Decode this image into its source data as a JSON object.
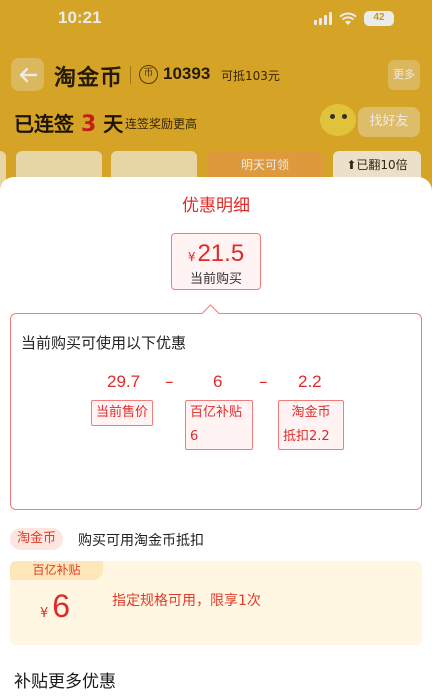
{
  "status_bar": {
    "time": "10:21",
    "battery": "42"
  },
  "header": {
    "title": "淘金币",
    "coin_symbol": "币",
    "coin_balance": "10393",
    "coin_deduct": "可抵103元",
    "more_label": "更多"
  },
  "streak": {
    "prefix": "已连签",
    "days": "3",
    "suffix": "天",
    "tip": "连签奖励更高",
    "invite_label": "找好友"
  },
  "cards": {
    "tomorrow_label": "明天可领",
    "double_label": "⬆已翻10倍"
  },
  "sheet": {
    "title": "优惠明细",
    "current_price": {
      "currency": "¥",
      "value": "21.5",
      "label": "当前购买"
    },
    "detail": {
      "title": "当前购买可使用以下优惠",
      "formula": {
        "price": "29.7",
        "minus1": "–",
        "subsidy": "6",
        "minus2": "–",
        "coin": "2.2",
        "price_tag": "当前售价",
        "subsidy_tag_line1": "百亿补贴",
        "subsidy_tag_line2": "6",
        "coin_tag_line1": "淘金币",
        "coin_tag_line2": "抵扣2.2"
      }
    },
    "coin_row": {
      "tag": "淘金币",
      "text": "购买可用淘金币抵扣"
    },
    "subsidy_card": {
      "tag": "百亿补贴",
      "currency": "¥",
      "value": "6",
      "desc": "指定规格可用，限享1次"
    },
    "more_heading": "补贴更多优惠"
  },
  "colors": {
    "accent_red": "#e02a2a",
    "background_gold": "#e8b22a"
  }
}
